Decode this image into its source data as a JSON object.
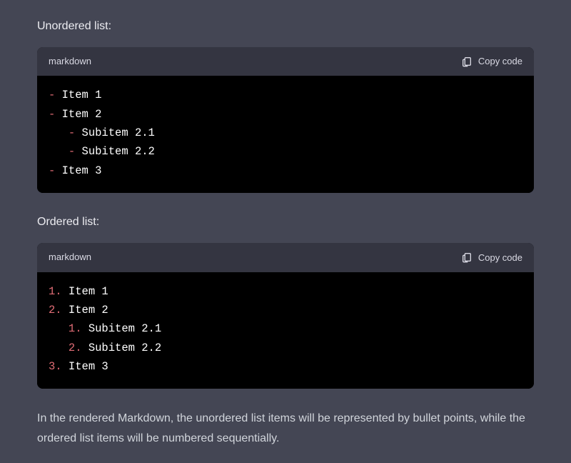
{
  "sections": {
    "unordered": {
      "label": "Unordered list:",
      "lang": "markdown",
      "copy_label": "Copy code",
      "tokens": [
        {
          "b": "-",
          "i": 0,
          "t": "Item 1"
        },
        {
          "b": "-",
          "i": 0,
          "t": "Item 2"
        },
        {
          "b": "-",
          "i": 1,
          "t": "Subitem 2.1"
        },
        {
          "b": "-",
          "i": 1,
          "t": "Subitem 2.2"
        },
        {
          "b": "-",
          "i": 0,
          "t": "Item 3"
        }
      ]
    },
    "ordered": {
      "label": "Ordered list:",
      "lang": "markdown",
      "copy_label": "Copy code",
      "tokens": [
        {
          "b": "1.",
          "i": 0,
          "t": "Item 1"
        },
        {
          "b": "2.",
          "i": 0,
          "t": "Item 2"
        },
        {
          "b": "1.",
          "i": 1,
          "t": "Subitem 2.1"
        },
        {
          "b": "2.",
          "i": 1,
          "t": "Subitem 2.2"
        },
        {
          "b": "3.",
          "i": 0,
          "t": "Item 3"
        }
      ]
    }
  },
  "footer_text": "In the rendered Markdown, the unordered list items will be represented by bullet points, while the ordered list items will be numbered sequentially."
}
